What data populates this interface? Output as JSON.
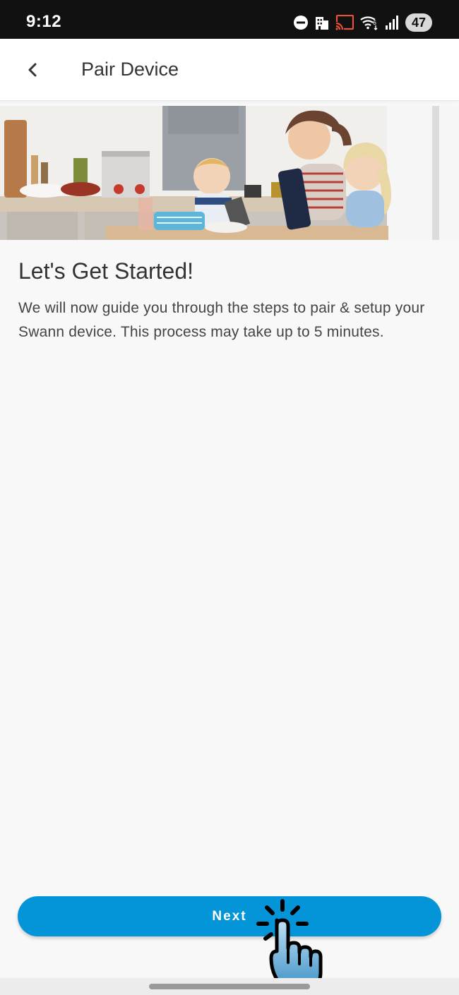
{
  "status_bar": {
    "time": "9:12",
    "battery": "47",
    "icons": [
      "do-not-disturb-icon",
      "building-icon",
      "cast-icon",
      "wifi-6-icon",
      "signal-icon",
      "battery-icon"
    ]
  },
  "app_bar": {
    "title": "Pair Device",
    "back_icon": "chevron-left-icon"
  },
  "hero": {
    "icon": "family-kitchen-illustration"
  },
  "content": {
    "heading": "Let's Get Started!",
    "description": "We will now guide you through the steps to pair & setup your Swann device. This process may take up to 5 minutes."
  },
  "actions": {
    "next_label": "Next"
  },
  "colors": {
    "accent": "#0395d8",
    "status_bar": "#111111",
    "background": "#f8f8f9"
  }
}
